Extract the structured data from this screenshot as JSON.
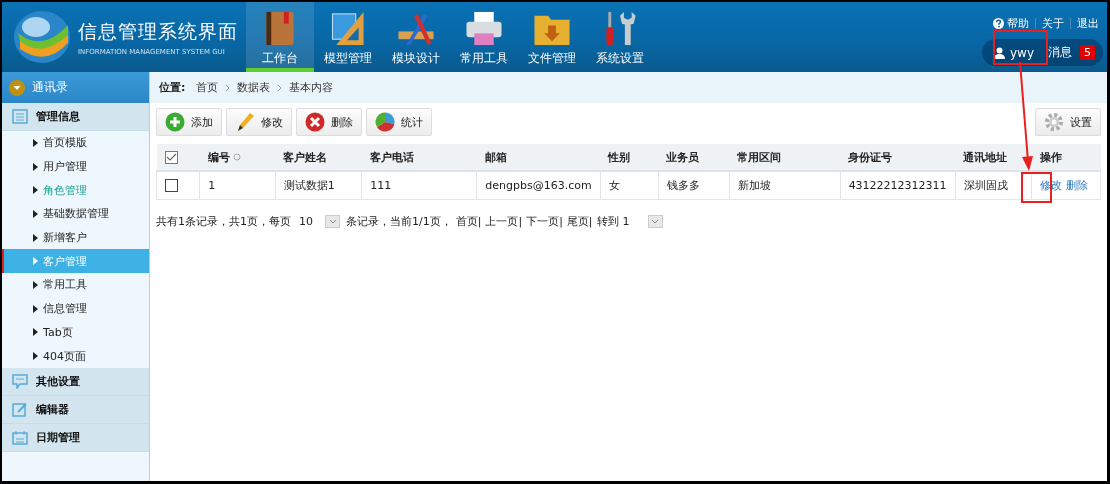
{
  "header": {
    "title": "信息管理系统界面",
    "subtitle": "INFORMATION MANAGEMENT SYSTEM GUI",
    "nav": [
      {
        "label": "工作台",
        "selected": true
      },
      {
        "label": "模型管理",
        "selected": false
      },
      {
        "label": "模块设计",
        "selected": false
      },
      {
        "label": "常用工具",
        "selected": false
      },
      {
        "label": "文件管理",
        "selected": false
      },
      {
        "label": "系统设置",
        "selected": false
      }
    ],
    "links": [
      "帮助",
      "关于",
      "退出"
    ],
    "user": "ywy",
    "messages_label": "消息",
    "messages_count": "5"
  },
  "sidebar": {
    "title": "通讯录",
    "groups": [
      {
        "label": "管理信息",
        "items": [
          {
            "label": "首页模版",
            "selected": false,
            "hovered": false
          },
          {
            "label": "用户管理",
            "selected": false,
            "hovered": false
          },
          {
            "label": "角色管理",
            "selected": false,
            "hovered": true
          },
          {
            "label": "基础数据管理",
            "selected": false,
            "hovered": false
          },
          {
            "label": "新增客户",
            "selected": false,
            "hovered": false
          },
          {
            "label": "客户管理",
            "selected": true,
            "hovered": false
          },
          {
            "label": "常用工具",
            "selected": false,
            "hovered": false
          },
          {
            "label": "信息管理",
            "selected": false,
            "hovered": false
          },
          {
            "label": "Tab页",
            "selected": false,
            "hovered": false
          },
          {
            "label": "404页面",
            "selected": false,
            "hovered": false
          }
        ]
      },
      {
        "label": "其他设置"
      },
      {
        "label": "编辑器"
      },
      {
        "label": "日期管理"
      }
    ]
  },
  "breadcrumb": {
    "label": "位置:",
    "items": [
      "首页",
      "数据表",
      "基本内容"
    ]
  },
  "toolbar": [
    "添加",
    "修改",
    "删除",
    "统计"
  ],
  "settings_button": "设置",
  "table": {
    "all_checked": true,
    "columns": [
      "编号",
      "客户姓名",
      "客户电话",
      "邮箱",
      "性别",
      "业务员",
      "常用区间",
      "身份证号",
      "通讯地址",
      "操作"
    ],
    "rows": [
      {
        "checked": false,
        "cells": [
          "1",
          "测试数据1",
          "111",
          "dengpbs@163.com",
          "女",
          "钱多多",
          "新加坡",
          "43122212312311",
          "深圳固戌"
        ],
        "actions": [
          "修改",
          "删除"
        ]
      }
    ]
  },
  "pagination": {
    "summary": "共有1条记录，共1页，每页",
    "page_size": "10",
    "status": "条记录，当前1/1页，",
    "links": [
      "首页|",
      "上一页|",
      "下一页|",
      "尾页|"
    ],
    "goto_label": "转到",
    "goto_value": "1"
  }
}
